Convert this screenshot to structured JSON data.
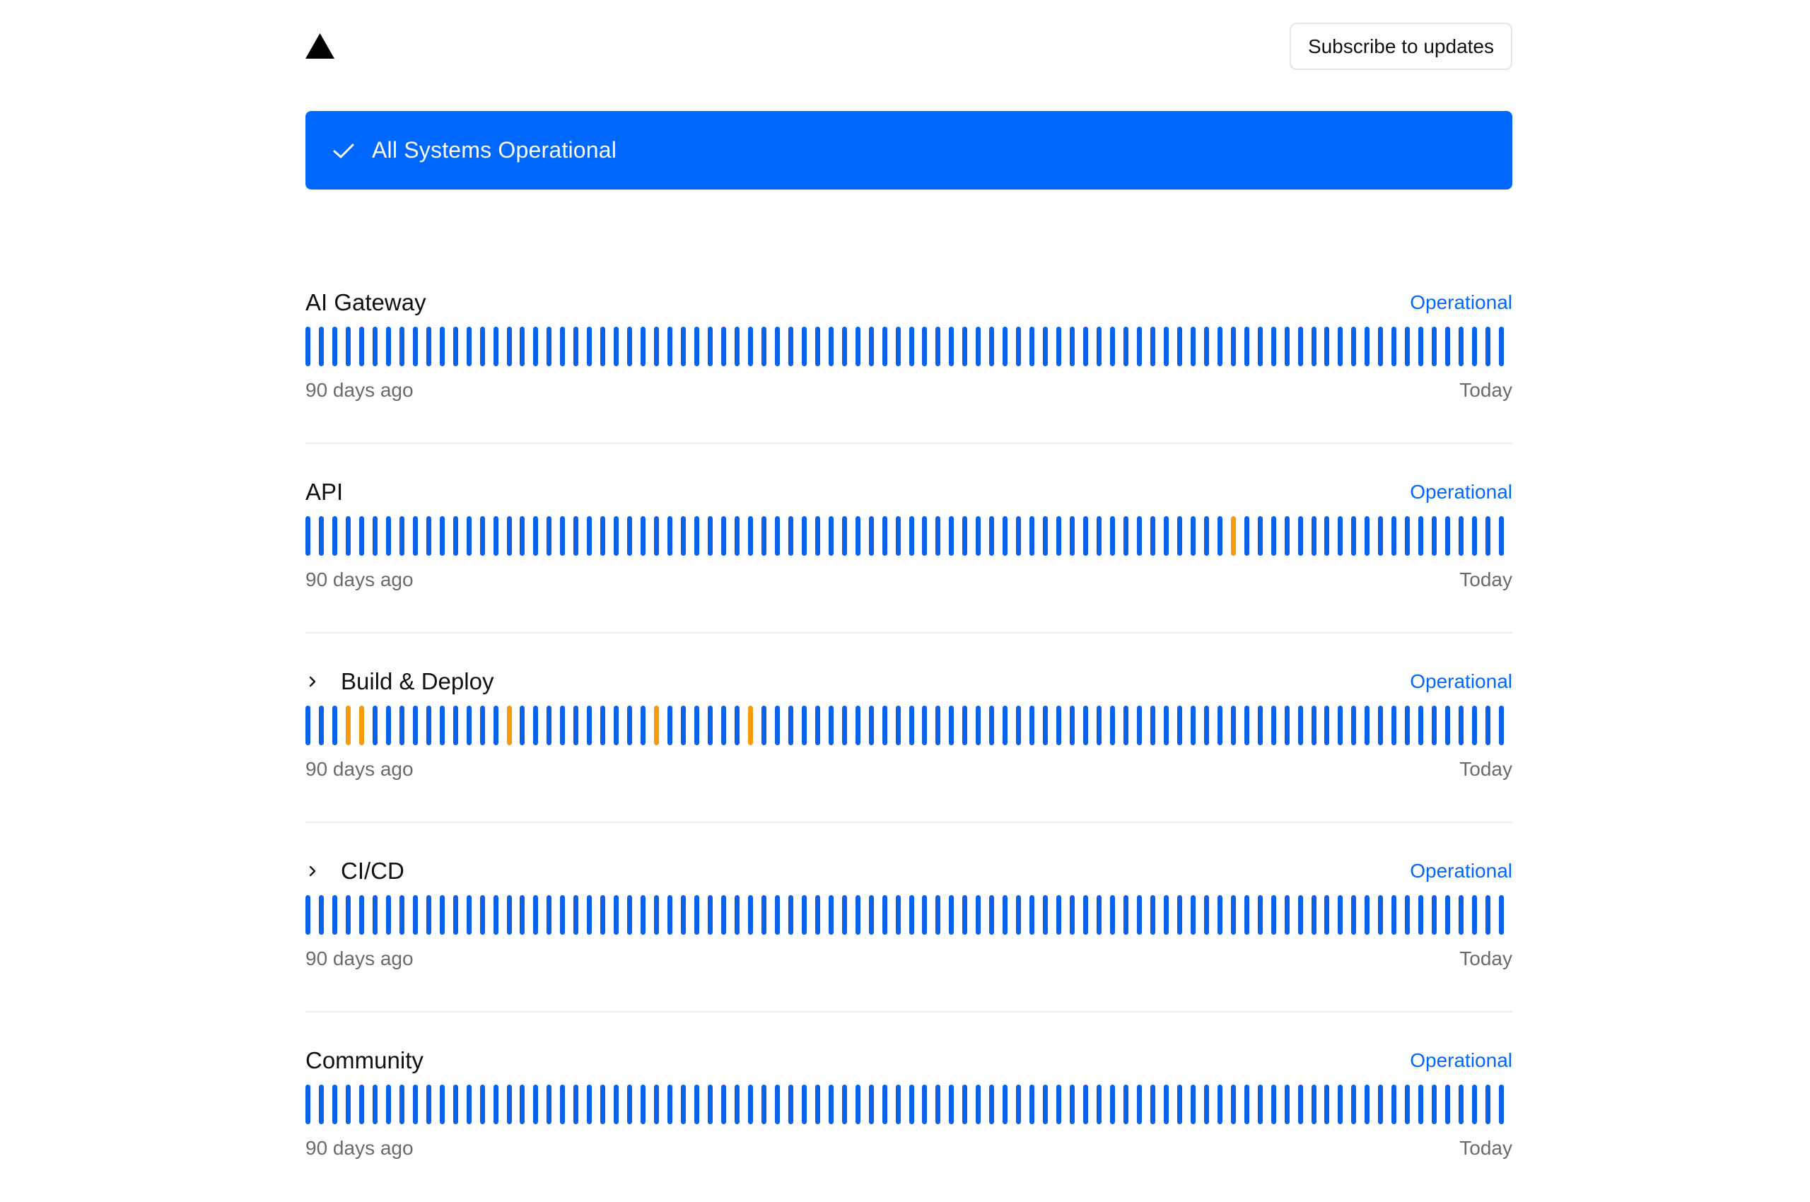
{
  "header": {
    "logo_icon": "vercel-triangle-icon",
    "subscribe_label": "Subscribe to updates"
  },
  "banner": {
    "icon": "check-icon",
    "text": "All Systems Operational",
    "color": "#0068ff"
  },
  "colors": {
    "operational": "#0a62ea",
    "degraded": "#f79b0c",
    "status_text": "#0068ff"
  },
  "components": [
    {
      "name": "AI Gateway",
      "expandable": false,
      "status": "Operational",
      "range_start": "90 days ago",
      "range_end": "Today",
      "degraded_days": []
    },
    {
      "name": "API",
      "expandable": false,
      "status": "Operational",
      "range_start": "90 days ago",
      "range_end": "Today",
      "degraded_days": [
        69
      ]
    },
    {
      "name": "Build & Deploy",
      "expandable": true,
      "status": "Operational",
      "range_start": "90 days ago",
      "range_end": "Today",
      "degraded_days": [
        3,
        4,
        15,
        26,
        33
      ]
    },
    {
      "name": "CI/CD",
      "expandable": true,
      "status": "Operational",
      "range_start": "90 days ago",
      "range_end": "Today",
      "degraded_days": []
    },
    {
      "name": "Community",
      "expandable": false,
      "status": "Operational",
      "range_start": "90 days ago",
      "range_end": "Today",
      "degraded_days": []
    }
  ],
  "days_shown": 90
}
